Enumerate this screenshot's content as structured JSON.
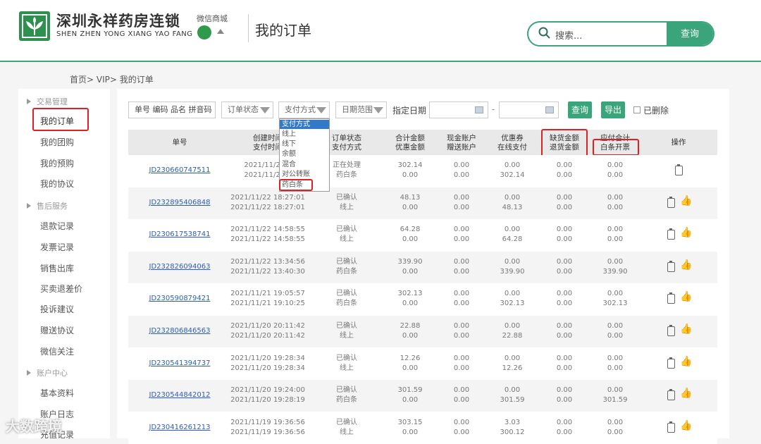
{
  "header": {
    "brand_cn": "深圳永祥药房连锁",
    "brand_en": "SHEN ZHEN YONG XIANG YAO FANG",
    "wechat_label": "微信商城",
    "page_title": "我的订单",
    "search_placeholder": "搜索...",
    "search_button": "查询"
  },
  "breadcrumb": "首页> VIP> 我的订单",
  "sidebar": {
    "group_trade": "交易管理",
    "item_orders": "我的订单",
    "item_group": "我的团购",
    "item_presale": "我的预购",
    "item_agreement": "我的协议",
    "group_aftersale": "售后服务",
    "item_refund": "退款记录",
    "item_invoice": "发票记录",
    "item_outbound": "销售出库",
    "item_buyreturn": "买卖退差价",
    "item_complaint": "投诉建议",
    "item_gift": "赠送协议",
    "item_wechat": "微信关注",
    "group_account": "账户中心",
    "item_profile": "基本资料",
    "item_log": "账户日志",
    "item_recharge": "充值记录"
  },
  "filters": {
    "order_no_placeholder": "单号 编码 品名 拼音码",
    "order_status": "订单状态",
    "pay_method": "支付方式",
    "date_range": "日期范围",
    "date_label": "指定日期",
    "date_sep": "-",
    "query_button": "查询",
    "export_button": "导出",
    "deleted_label": "已删除"
  },
  "pay_dropdown": {
    "options": [
      "支付方式",
      "线上",
      "线下",
      "余额",
      "混合",
      "对公转账",
      "药白条"
    ]
  },
  "table": {
    "headers": {
      "order_no": "单号",
      "created_1": "创建时间",
      "created_2": "支付时间",
      "status_1": "订单状态",
      "status_2": "支付方式",
      "total_1": "合计金额",
      "total_2": "优惠金额",
      "cash_1": "现金账户",
      "cash_2": "赠送账户",
      "coupon_1": "优惠券",
      "coupon_2": "在线支付",
      "short_1": "缺货金额",
      "short_2": "退货金额",
      "due_1": "应付合计",
      "due_2": "白条开票",
      "op": "操作"
    },
    "rows": [
      {
        "no": "JD230660747511",
        "t1": "2021/11/23 1",
        "t2": "2021/11/23 1",
        "s1": "正在处理",
        "s2": "药白条",
        "a1": "302.14",
        "a2": "0.00",
        "b1": "0.00",
        "b2": "0.00",
        "c1": "0.00",
        "c2": "302.14",
        "d1": "0.00",
        "d2": "0.00",
        "e1": "0.00",
        "e2": "0.00",
        "thumb": false
      },
      {
        "no": "JD232895406848",
        "t1": "2021/11/22 18:27:01",
        "t2": "2021/11/22 18:27:01",
        "s1": "已确认",
        "s2": "线上",
        "a1": "48.13",
        "a2": "0.00",
        "b1": "0.00",
        "b2": "0.00",
        "c1": "0.00",
        "c2": "48.13",
        "d1": "0.00",
        "d2": "0.00",
        "e1": "0.00",
        "e2": "0.00",
        "thumb": true
      },
      {
        "no": "JD230617538741",
        "t1": "2021/11/22 14:58:55",
        "t2": "2021/11/22 14:58:55",
        "s1": "已确认",
        "s2": "线上",
        "a1": "64.28",
        "a2": "0.00",
        "b1": "0.00",
        "b2": "0.00",
        "c1": "0.00",
        "c2": "64.28",
        "d1": "0.00",
        "d2": "0.00",
        "e1": "0.00",
        "e2": "0.00",
        "thumb": true
      },
      {
        "no": "JD232826094063",
        "t1": "2021/11/22 13:34:56",
        "t2": "2021/11/22 13:40:30",
        "s1": "已确认",
        "s2": "药白条",
        "a1": "339.90",
        "a2": "0.00",
        "b1": "0.00",
        "b2": "0.00",
        "c1": "0.00",
        "c2": "339.90",
        "d1": "0.00",
        "d2": "0.00",
        "e1": "0.00",
        "e2": "339.90",
        "thumb": true
      },
      {
        "no": "JD230590879421",
        "t1": "2021/11/21 19:05:57",
        "t2": "2021/11/21 19:10:25",
        "s1": "已确认",
        "s2": "药白条",
        "a1": "302.13",
        "a2": "0.00",
        "b1": "0.00",
        "b2": "0.00",
        "c1": "0.00",
        "c2": "302.13",
        "d1": "0.00",
        "d2": "0.00",
        "e1": "0.00",
        "e2": "302.13",
        "thumb": true
      },
      {
        "no": "JD232806846563",
        "t1": "2021/11/20 20:11:42",
        "t2": "2021/11/20 20:11:42",
        "s1": "已确认",
        "s2": "线上",
        "a1": "22.88",
        "a2": "0.00",
        "b1": "0.00",
        "b2": "0.00",
        "c1": "0.00",
        "c2": "22.88",
        "d1": "0.00",
        "d2": "0.00",
        "e1": "0.00",
        "e2": "0.00",
        "thumb": true
      },
      {
        "no": "JD230541394737",
        "t1": "2021/11/20 19:28:34",
        "t2": "2021/11/20 19:28:34",
        "s1": "已确认",
        "s2": "线上",
        "a1": "12.26",
        "a2": "0.00",
        "b1": "0.00",
        "b2": "0.00",
        "c1": "0.00",
        "c2": "12.26",
        "d1": "0.00",
        "d2": "0.00",
        "e1": "0.00",
        "e2": "0.00",
        "thumb": true
      },
      {
        "no": "JD230544842012",
        "t1": "2021/11/20 19:24:00",
        "t2": "2021/11/20 19:28:19",
        "s1": "已确认",
        "s2": "药白条",
        "a1": "301.59",
        "a2": "0.00",
        "b1": "0.00",
        "b2": "0.00",
        "c1": "0.00",
        "c2": "301.59",
        "d1": "0.00",
        "d2": "0.00",
        "e1": "0.00",
        "e2": "301.59",
        "thumb": true
      },
      {
        "no": "JD230416261213",
        "t1": "2021/11/19 19:36:56",
        "t2": "2021/11/19 19:36:56",
        "s1": "已确认",
        "s2": "线上",
        "a1": "303.15",
        "a2": "0.00",
        "b1": "0.00",
        "b2": "0.00",
        "c1": "3.03",
        "c2": "300.12",
        "d1": "0.00",
        "d2": "0.00",
        "e1": "0.00",
        "e2": "0.00",
        "thumb": true
      }
    ]
  },
  "watermark": "大数跨境",
  "colors": {
    "brand_green": "#3aa57a",
    "highlight_red": "#e02020",
    "link_blue": "#2c5db8",
    "thumb_yellow": "#f0a500"
  }
}
